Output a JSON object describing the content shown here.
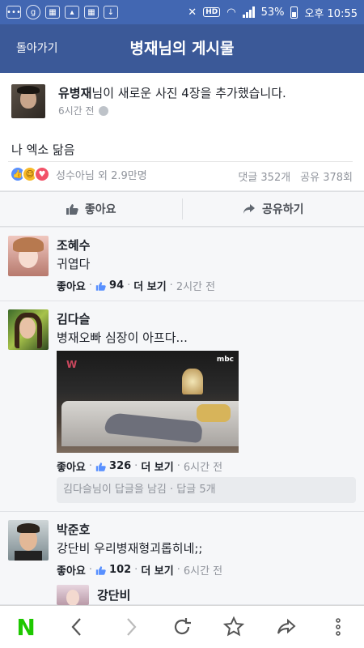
{
  "status_bar": {
    "battery": "53%",
    "time": "오후 10:55",
    "hd_label": "HD",
    "left_icons": [
      "chat-icon",
      "g-icon",
      "cal-icon",
      "image-icon",
      "cal2-icon",
      "download-icon"
    ]
  },
  "header": {
    "back_label": "돌아가기",
    "title": "병재님의 게시물"
  },
  "post": {
    "author": "유병재",
    "headline_rest": "님이 새로운 사진 4장을 추가했습니다.",
    "time": "6시간 전",
    "text": "나 엑소 닮음",
    "reactions_text": "성수아님 외 2.9만명",
    "comments_count": "댓글 352개",
    "shares_count": "공유 378회"
  },
  "actions": {
    "like_label": "좋아요",
    "share_label": "공유하기"
  },
  "comments": [
    {
      "name": "조혜수",
      "text": "귀엽다",
      "like_label": "좋아요",
      "likes": "94",
      "more_label": "더 보기",
      "time": "2시간 전"
    },
    {
      "name": "김다슬",
      "text": "병재오빠 심장이 아프다...",
      "like_label": "좋아요",
      "likes": "326",
      "more_label": "더 보기",
      "time": "6시간 전",
      "replies": "김다슬님이 답글을 남김 · 답글 5개",
      "photo_watermark": "mbc",
      "photo_mark": "W"
    },
    {
      "name": "박준호",
      "text": "강단비 우리병재형괴롭히네;;",
      "like_label": "좋아요",
      "likes": "102",
      "more_label": "더 보기",
      "time": "6시간 전"
    }
  ],
  "reply_preview": {
    "name": "강단비"
  },
  "colors": {
    "brand": "#3b5998",
    "status_bar": "#4267b2",
    "naver": "#1ec800"
  },
  "bottom_nav": {
    "logo": "N"
  }
}
